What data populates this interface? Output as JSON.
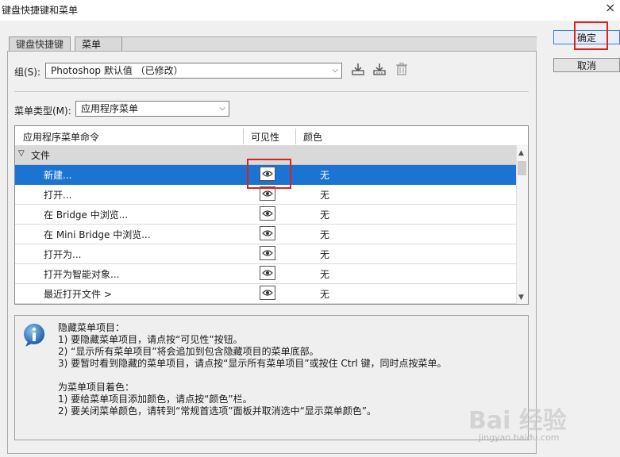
{
  "window": {
    "title": "键盘快捷键和菜单",
    "close_glyph": "×"
  },
  "tabs": [
    {
      "label": "键盘快捷键"
    },
    {
      "label": "菜单"
    }
  ],
  "set": {
    "label": "组(S):",
    "value": "Photoshop 默认值 （已修改）",
    "arrow": "⌵"
  },
  "menu_type": {
    "label": "菜单类型(M):",
    "value": "应用程序菜单",
    "arrow": "⌵"
  },
  "table": {
    "columns": [
      "应用程序菜单命令",
      "可见性",
      "颜色"
    ],
    "group": {
      "toggle": "▽",
      "label": "文件"
    },
    "rows": [
      {
        "name": "新建...",
        "color": "无",
        "selected": true
      },
      {
        "name": "打开...",
        "color": "无"
      },
      {
        "name": "在 Bridge 中浏览...",
        "color": "无"
      },
      {
        "name": "在 Mini Bridge 中浏览...",
        "color": "无"
      },
      {
        "name": "打开为...",
        "color": "无"
      },
      {
        "name": "打开为智能对象...",
        "color": "无"
      },
      {
        "name": "最近打开文件 >",
        "color": "无"
      }
    ],
    "scroll_up": "▲",
    "scroll_down": "▼"
  },
  "info": {
    "text": "隐藏菜单项目：\n1) 要隐藏菜单项目，请点按“可见性”按钮。\n2) “显示所有菜单项目”将会追加到包含隐藏项目的菜单底部。\n3) 要暂时看到隐藏的菜单项目，请点按“显示所有菜单项目”或按住 Ctrl 键，同时点按菜单。\n\n为菜单项目着色：\n1) 要给菜单项目添加颜色，请点按“颜色”栏。\n2) 要关闭菜单颜色，请转到“常规首选项”面板并取消选中“显示菜单颜色”。"
  },
  "buttons": {
    "ok": "确定",
    "cancel": "取消"
  },
  "watermark": {
    "main": "Bai 经验",
    "sub": "jingyan.baidu.com"
  },
  "colors": {
    "selection": "#1c74d2",
    "highlight": "#e01f1f"
  }
}
